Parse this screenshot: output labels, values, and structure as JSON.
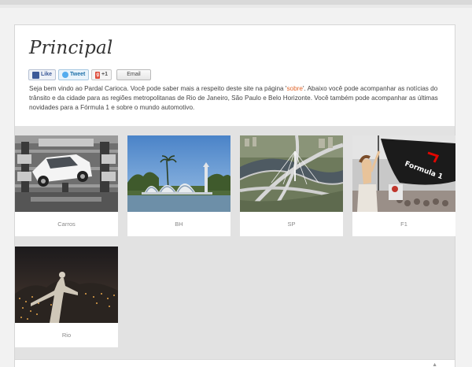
{
  "page": {
    "title": "Principal",
    "social": {
      "like_label": "Like",
      "tweet_label": "Tweet",
      "gplus_label": "+1",
      "email_label": "Email"
    },
    "intro": {
      "before_link": "Seja bem vindo ao Pardal Carioca. Você pode saber mais a respeito deste site na página '",
      "link_text": "sobre",
      "after_link": "'. Abaixo você pode acompanhar as notícias do trânsito e da cidade para as regiões metropolitanas de Rio de Janeiro, São Paulo e Belo Horizonte. Você também pode acompanhar as últimas novidades para a Fórmula 1 e sobre o mundo automotivo."
    }
  },
  "tiles": [
    {
      "caption": "Carros"
    },
    {
      "caption": "BH"
    },
    {
      "caption": "SP"
    },
    {
      "caption": "F1"
    },
    {
      "caption": "Rio"
    }
  ],
  "colors": {
    "link": "#e0662c",
    "background": "#f2f2f2",
    "card": "#ffffff",
    "grid_area": "#e2e2e2"
  }
}
